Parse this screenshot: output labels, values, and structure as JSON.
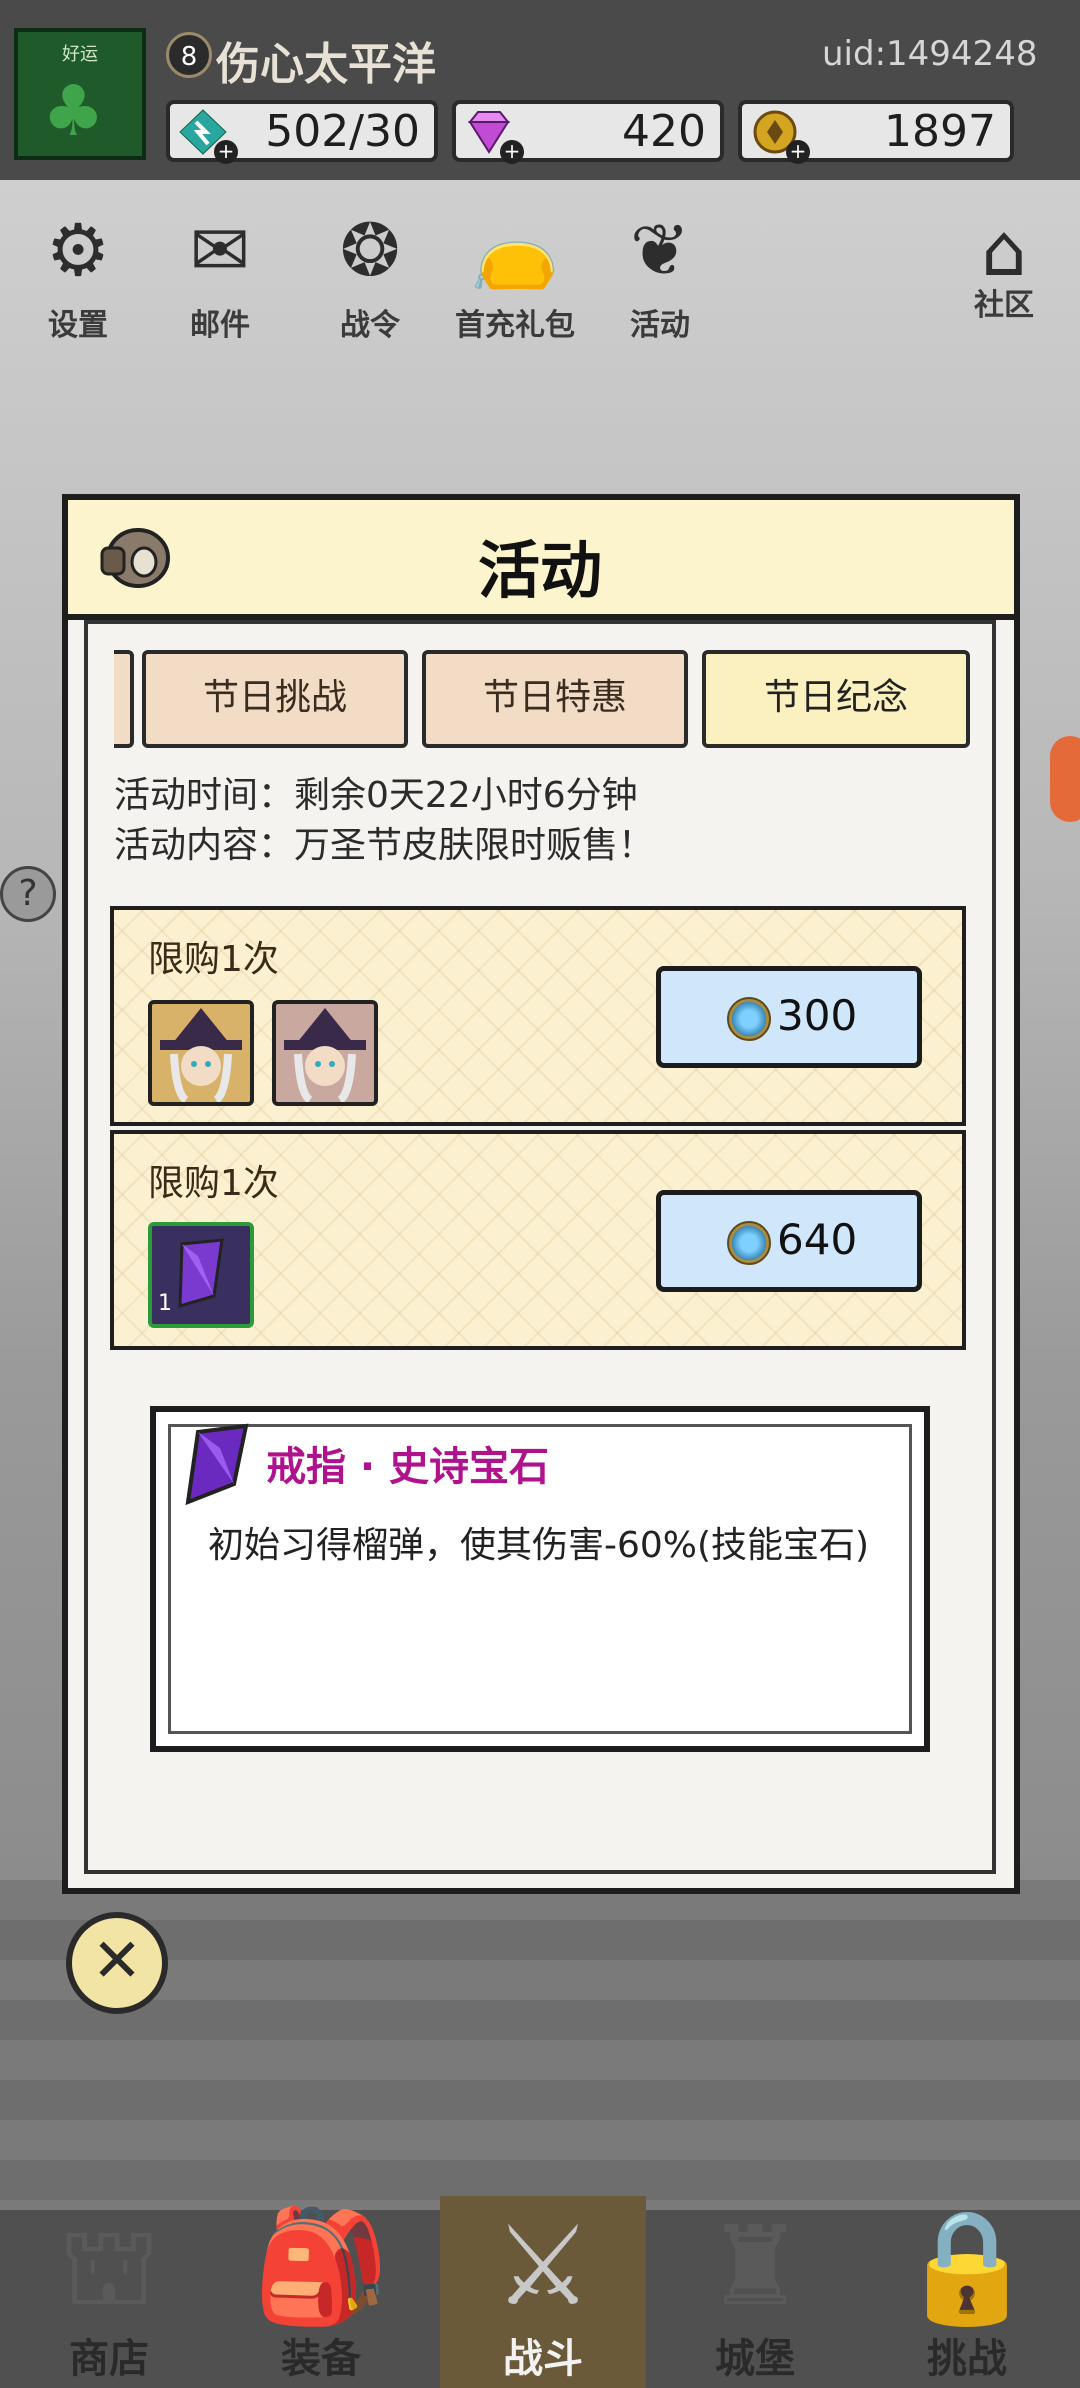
{
  "header": {
    "avatar_tag": "好运",
    "level": "8",
    "player_name": "伤心太平洋",
    "uid": "uid:1494248",
    "resources": [
      {
        "icon": "energy-icon",
        "value": "502/30",
        "color": "#2aa6a0"
      },
      {
        "icon": "gem-icon",
        "value": "420",
        "color": "#c24bd6"
      },
      {
        "icon": "gold-coin-icon",
        "value": "1897",
        "color": "#d4a520"
      }
    ]
  },
  "top_menu": [
    {
      "icon": "gear-icon",
      "label": "设置"
    },
    {
      "icon": "mail-icon",
      "label": "邮件"
    },
    {
      "icon": "battle-pass-icon",
      "label": "战令"
    },
    {
      "icon": "gift-bag-icon",
      "label": "首充礼包"
    },
    {
      "icon": "laurel-icon",
      "label": "活动"
    },
    {
      "icon": "home-icon",
      "label": "社区"
    }
  ],
  "panel": {
    "title": "活动",
    "tabs": [
      {
        "label": "节日挑战",
        "active": false
      },
      {
        "label": "节日特惠",
        "active": false
      },
      {
        "label": "节日纪念",
        "active": true
      }
    ],
    "activity_time": "活动时间：剩余0天22小时6分钟",
    "activity_content": "活动内容：万圣节皮肤限时贩售！",
    "offers": [
      {
        "limit": "限购1次",
        "items": [
          "witch-skin-icon",
          "witch-skin-icon"
        ],
        "price": "300"
      },
      {
        "limit": "限购1次",
        "items": [
          "purple-crystal-icon"
        ],
        "item_count": "1",
        "price": "640"
      }
    ],
    "gem_detail": {
      "name": "戒指 · 史诗宝石",
      "description": "初始习得榴弹，使其伤害-60%(技能宝石)"
    }
  },
  "bottom_nav": [
    {
      "label": "商店",
      "icon": "shop-icon",
      "active": false
    },
    {
      "label": "装备",
      "icon": "backpack-icon",
      "active": false
    },
    {
      "label": "战斗",
      "icon": "crossed-swords-icon",
      "active": true
    },
    {
      "label": "城堡",
      "icon": "castle-icon",
      "active": false
    },
    {
      "label": "挑战",
      "icon": "locked-challenge-icon",
      "active": false
    }
  ]
}
